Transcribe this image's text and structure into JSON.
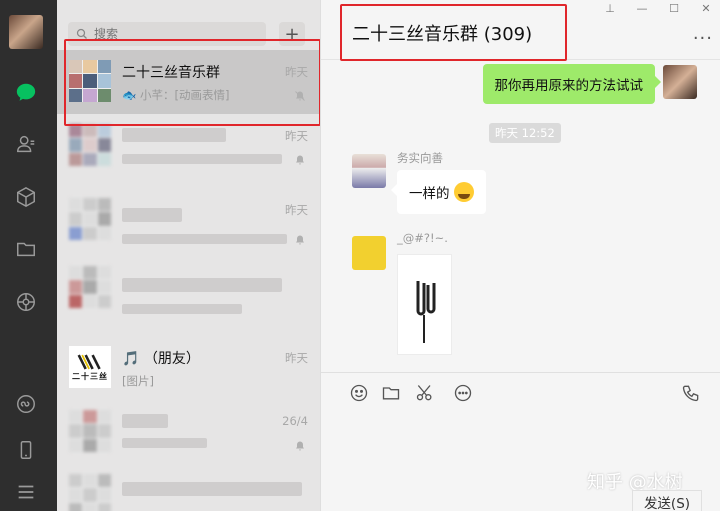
{
  "search": {
    "placeholder": "搜索"
  },
  "conversations": [
    {
      "name": "二十三丝音乐群",
      "preview": "小芊：[动画表情]",
      "time": "昨天"
    },
    {
      "name": "",
      "preview": "",
      "time": "昨天"
    },
    {
      "name": "",
      "preview": "",
      "time": "昨天"
    },
    {
      "name": "",
      "preview": "",
      "time": ""
    },
    {
      "name": "🎵 （朋友）",
      "preview": "[图片]",
      "time": "昨天",
      "logo_text": "二十三丝"
    },
    {
      "name": "",
      "preview": "",
      "time": "26/4"
    }
  ],
  "chat": {
    "title": "二十三丝音乐群 (309)",
    "messages": [
      {
        "type": "out",
        "text": "那你再用原来的方法试试"
      },
      {
        "type": "timestamp",
        "text": "昨天 12:52"
      },
      {
        "type": "in",
        "sender": "务实向善",
        "text": "一样的"
      },
      {
        "type": "in-image",
        "sender": "_@#?!~."
      }
    ],
    "send_label": "发送(S)"
  },
  "watermark": "知乎 @水树",
  "colors": {
    "accent_green": "#9eea6a",
    "highlight_red": "#e0262b",
    "sidebar_bg": "#2e2e2e"
  }
}
